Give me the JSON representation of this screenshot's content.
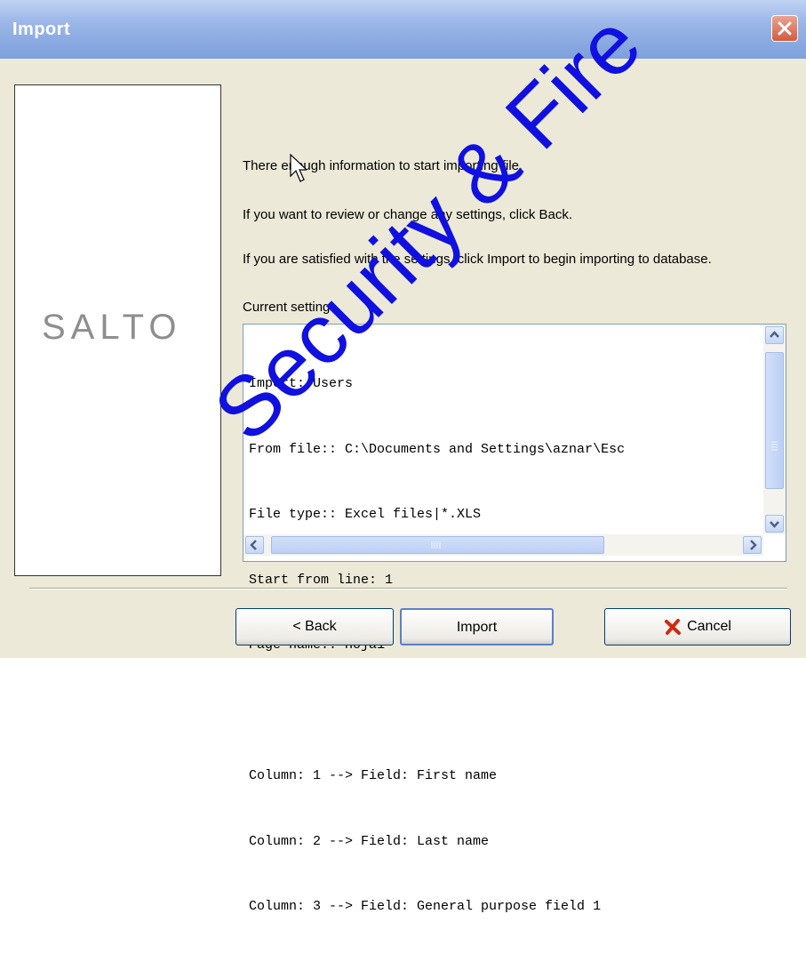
{
  "window": {
    "title": "Import"
  },
  "logo": {
    "text": "SALTO"
  },
  "messages": {
    "line1": "There  enough information to start importing file.",
    "line2": "If you want to review or change any settings, click Back.",
    "line3": "If you are satisfied with the settings, click Import to begin importing to database."
  },
  "settings": {
    "label": "Current settings",
    "lines": [
      "Import: Users",
      "From file:: C:\\Documents and Settings\\aznar\\Esc",
      "File type:: Excel files|*.XLS",
      "Start from line: 1",
      "Page name:: Hoja1",
      "",
      "Column: 1 --> Field: First name",
      "Column: 2 --> Field: Last name",
      "Column: 3 --> Field: General purpose field 1"
    ]
  },
  "buttons": {
    "back": "< Back",
    "import": "Import",
    "cancel": "Cancel"
  },
  "watermark": {
    "text": "Security & Fire"
  },
  "colors": {
    "title_bar": "#7d9fdc",
    "close": "#d45b3e",
    "cancel_x": "#d02a10",
    "watermark": "#1010e0"
  }
}
